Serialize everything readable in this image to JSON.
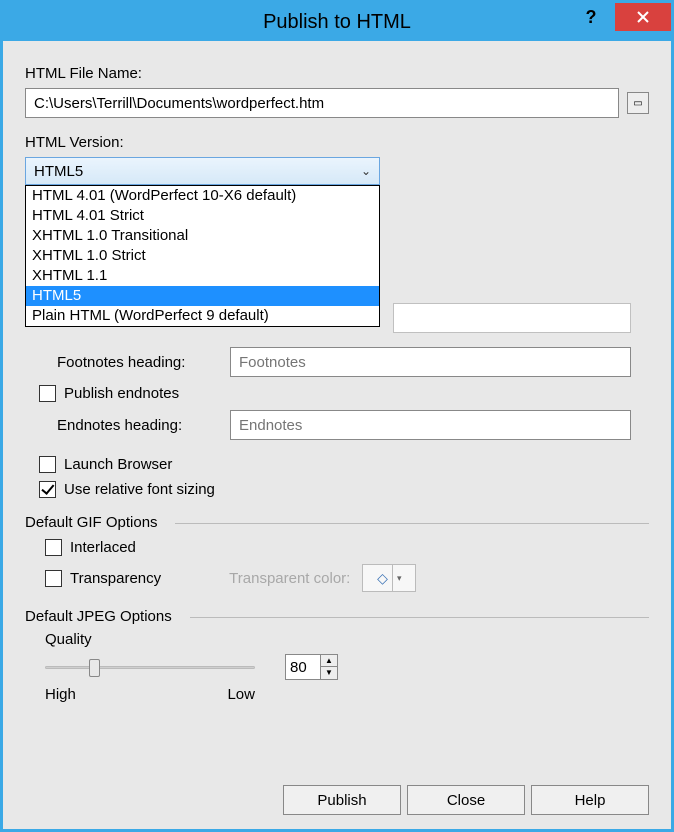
{
  "titlebar": {
    "title": "Publish to HTML"
  },
  "filename": {
    "label": "HTML File Name:",
    "value": "C:\\Users\\Terrill\\Documents\\wordperfect.htm"
  },
  "version": {
    "label": "HTML Version:",
    "selected": "HTML5",
    "options": [
      "HTML 4.01 (WordPerfect 10-X6 default)",
      "HTML 4.01 Strict",
      "XHTML 1.0 Transitional",
      "XHTML 1.0 Strict",
      "XHTML 1.1",
      "HTML5",
      "Plain HTML (WordPerfect 9 default)"
    ],
    "highlight_index": 5
  },
  "footnotes": {
    "heading_label": "Footnotes heading:",
    "heading_placeholder": "Footnotes"
  },
  "endnotes": {
    "publish_label": "Publish endnotes",
    "publish_checked": false,
    "heading_label": "Endnotes heading:",
    "heading_placeholder": "Endnotes"
  },
  "launch_browser": {
    "label": "Launch Browser",
    "checked": false
  },
  "relative_font": {
    "label": "Use relative font sizing",
    "checked": true
  },
  "gif": {
    "group_label": "Default GIF Options",
    "interlaced": {
      "label": "Interlaced",
      "checked": false
    },
    "transparency": {
      "label": "Transparency",
      "checked": false
    },
    "transparent_color_label": "Transparent color:"
  },
  "jpeg": {
    "group_label": "Default JPEG Options",
    "quality_label": "Quality",
    "value": "80",
    "high_label": "High",
    "low_label": "Low"
  },
  "buttons": {
    "publish": "Publish",
    "close": "Close",
    "help": "Help"
  }
}
